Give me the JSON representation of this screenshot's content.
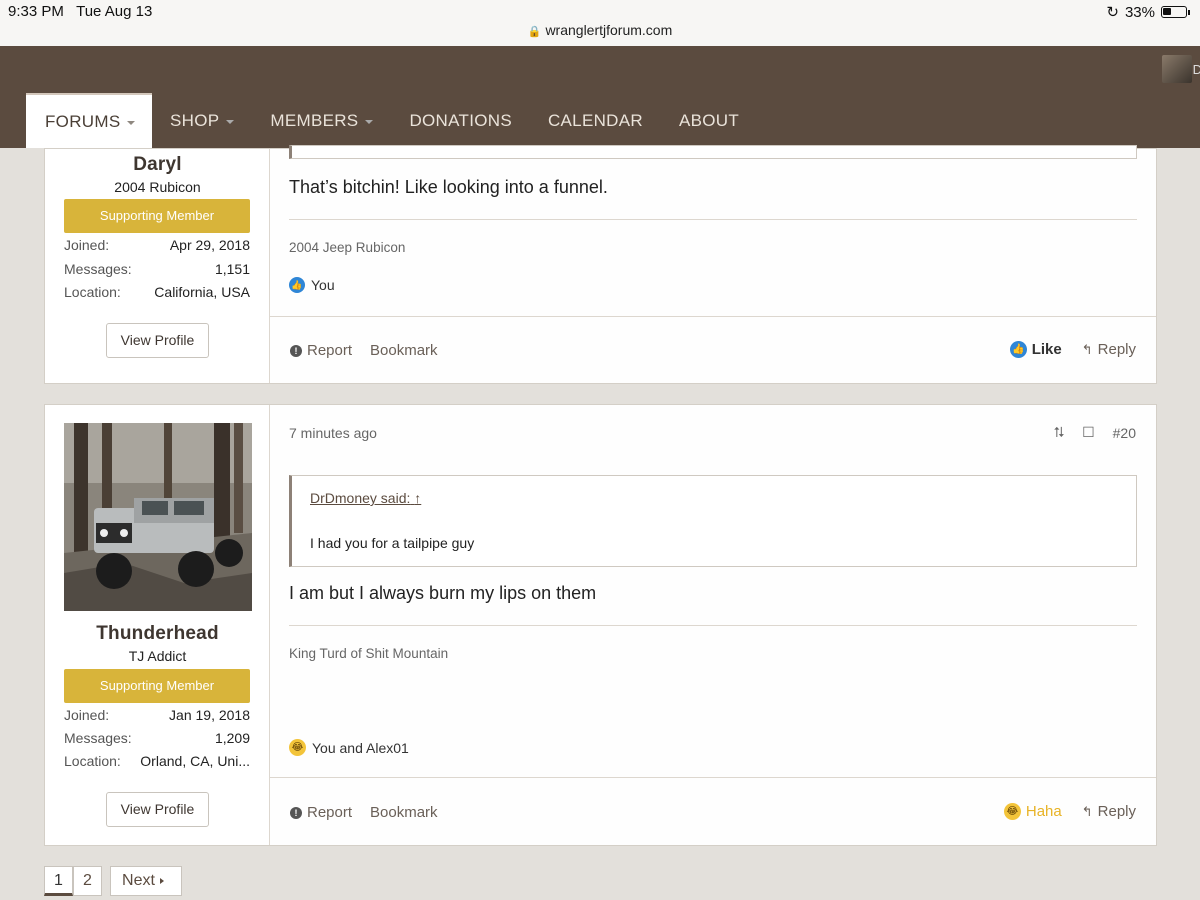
{
  "status_bar": {
    "time": "9:33 PM",
    "date": "Tue Aug 13",
    "battery": "33%",
    "url": "wranglertjforum.com"
  },
  "nav": {
    "items": [
      {
        "label": "FORUMS",
        "dropdown": true,
        "active": true
      },
      {
        "label": "SHOP",
        "dropdown": true
      },
      {
        "label": "MEMBERS",
        "dropdown": true
      },
      {
        "label": "DONATIONS"
      },
      {
        "label": "CALENDAR"
      },
      {
        "label": "ABOUT"
      }
    ]
  },
  "header": {
    "avatar_letter": "D"
  },
  "posts": [
    {
      "user": {
        "name": "Daryl",
        "title": "2004 Rubicon",
        "badge": "Supporting Member",
        "joined_label": "Joined:",
        "joined": "Apr 29, 2018",
        "messages_label": "Messages:",
        "messages": "1,151",
        "location_label": "Location:",
        "location": "California, USA",
        "view_profile": "View Profile"
      },
      "message": "That’s bitchin! Like looking into a funnel.",
      "signature": "2004 Jeep Rubicon",
      "reactions": "You",
      "footer": {
        "report": "Report",
        "bookmark": "Bookmark",
        "reaction": "Like",
        "reply": "Reply"
      }
    },
    {
      "user": {
        "name": "Thunderhead",
        "title": "TJ Addict",
        "badge": "Supporting Member",
        "joined_label": "Joined:",
        "joined": "Jan 19, 2018",
        "messages_label": "Messages:",
        "messages": "1,209",
        "location_label": "Location:",
        "location": "Orland, CA, Uni...",
        "view_profile": "View Profile"
      },
      "time": "7 minutes ago",
      "post_number": "#20",
      "quote": {
        "author": "DrDmoney said:",
        "text": "I had you for a tailpipe guy"
      },
      "message": "I am but I always burn my lips on them",
      "signature": "King Turd of Shit Mountain",
      "reactions": "You and Alex01",
      "footer": {
        "report": "Report",
        "bookmark": "Bookmark",
        "reaction": "Haha",
        "reply": "Reply"
      }
    }
  ],
  "pagination": {
    "pages": [
      "1",
      "2"
    ],
    "current": "1",
    "next": "Next"
  },
  "colors": {
    "header": "#5b4b3f",
    "badge": "#d8b43a",
    "like": "#2f86d6",
    "haha": "#e8b326"
  }
}
